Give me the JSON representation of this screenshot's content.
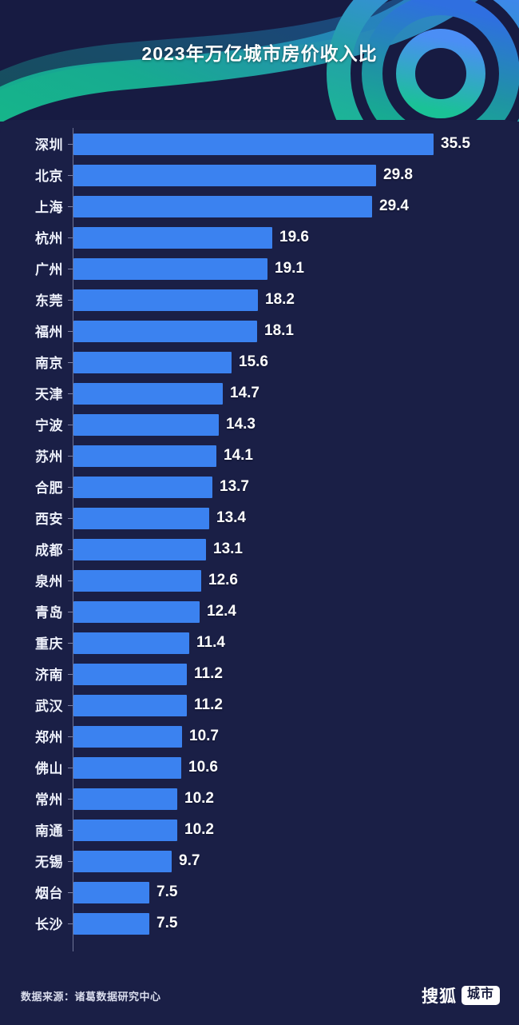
{
  "header": {
    "title": "2023年万亿城市房价收入比"
  },
  "footer": {
    "source": "数据来源：诸葛数据研究中心",
    "brand_name": "搜狐",
    "brand_badge": "城市"
  },
  "colors": {
    "background": "#1a1f46",
    "header_background": "#171b42",
    "bar": "#3b82f0",
    "axis": "#6e7496",
    "label_text": "#eef1fb",
    "value_text": "#ffffff",
    "decor_blue": "#2f6fe0",
    "decor_teal": "#19b88f"
  },
  "chart_data": {
    "type": "bar",
    "orientation": "horizontal",
    "title": "2023年万亿城市房价收入比",
    "xlabel": "",
    "ylabel": "",
    "xlim": [
      0,
      35.5
    ],
    "grid": false,
    "legend": null,
    "source": "数据来源：诸葛数据研究中心",
    "categories": [
      "深圳",
      "北京",
      "上海",
      "杭州",
      "广州",
      "东莞",
      "福州",
      "南京",
      "天津",
      "宁波",
      "苏州",
      "合肥",
      "西安",
      "成都",
      "泉州",
      "青岛",
      "重庆",
      "济南",
      "武汉",
      "郑州",
      "佛山",
      "常州",
      "南通",
      "无锡",
      "烟台",
      "长沙"
    ],
    "values": [
      35.5,
      29.8,
      29.4,
      19.6,
      19.1,
      18.2,
      18.1,
      15.6,
      14.7,
      14.3,
      14.1,
      13.7,
      13.4,
      13.1,
      12.6,
      12.4,
      11.4,
      11.2,
      11.2,
      10.7,
      10.6,
      10.2,
      10.2,
      9.7,
      7.5,
      7.5
    ],
    "value_labels": [
      "35.5",
      "29.8",
      "29.4",
      "19.6",
      "19.1",
      "18.2",
      "18.1",
      "15.6",
      "14.7",
      "14.3",
      "14.1",
      "13.7",
      "13.4",
      "13.1",
      "12.6",
      "12.4",
      "11.4",
      "11.2",
      "11.2",
      "10.7",
      "10.6",
      "10.2",
      "10.2",
      "9.7",
      "7.5",
      "7.5"
    ]
  }
}
